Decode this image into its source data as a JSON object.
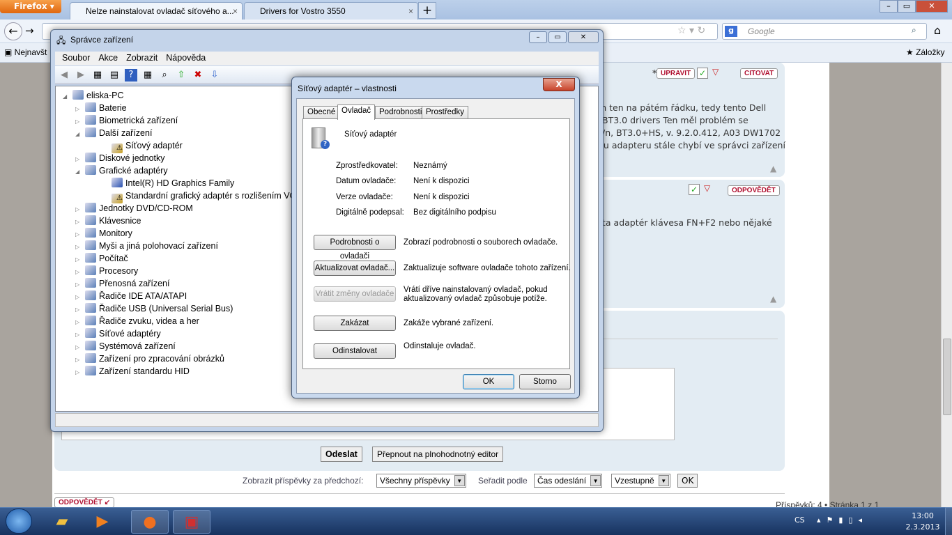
{
  "browser": {
    "menu_button": "Firefox",
    "tabs": [
      {
        "title": "Nelze nainstalovat ovladač síťového a..."
      },
      {
        "title": "Drivers for Vostro 3550"
      }
    ],
    "search_placeholder": "Google",
    "bookmarks_left": "Nejnavšt",
    "bookmarks_right": "Záložky"
  },
  "forum": {
    "post1": {
      "buttons": {
        "edit": "UPRAVIT",
        "quote": "CITOVAT"
      },
      "lines": [
        "m ten na pátém řádku, tedy tento Dell",
        "BT3.0 drivers Ten měl problém se",
        "/n, BT3.0+HS, v. 9.2.0.412, A03 DW1702",
        "nu adapteru stále chybí ve správci zařízení"
      ]
    },
    "post2": {
      "buttons": {
        "reply": "ODPOVĚDĚT"
      },
      "lines": [
        "ta adaptér klávesa FN+F2 nebo nějaké"
      ]
    },
    "submit": "Odeslat",
    "full_editor": "Přepnout na plnohodnotný editor",
    "filter_label": "Zobrazit příspěvky za předchozí:",
    "filter_value": "Všechny příspěvky",
    "sort_label": "Seřadit podle",
    "sort_value": "Čas odeslání",
    "order_value": "Vzestupně",
    "ok": "OK",
    "reply_button": "ODPOVĚDĚT",
    "pagination": "Příspěvků: 4 • Stránka 1 z 1"
  },
  "device_manager": {
    "title": "Správce zařízení",
    "menu": [
      "Soubor",
      "Akce",
      "Zobrazit",
      "Nápověda"
    ],
    "tree": [
      {
        "label": "eliska-PC",
        "level": 0,
        "state": "expanded"
      },
      {
        "label": "Baterie",
        "level": 1,
        "state": "collapsed"
      },
      {
        "label": "Biometrická zařízení",
        "level": 1,
        "state": "collapsed"
      },
      {
        "label": "Další zařízení",
        "level": 1,
        "state": "expanded"
      },
      {
        "label": "Síťový adaptér",
        "level": 2,
        "state": "warning"
      },
      {
        "label": "Diskové jednotky",
        "level": 1,
        "state": "collapsed"
      },
      {
        "label": "Grafické adaptéry",
        "level": 1,
        "state": "expanded"
      },
      {
        "label": "Intel(R) HD Graphics Family",
        "level": 2,
        "state": "leaf"
      },
      {
        "label": "Standardní grafický adaptér s rozlišením VGA",
        "level": 2,
        "state": "warning"
      },
      {
        "label": "Jednotky DVD/CD-ROM",
        "level": 1,
        "state": "collapsed"
      },
      {
        "label": "Klávesnice",
        "level": 1,
        "state": "collapsed"
      },
      {
        "label": "Monitory",
        "level": 1,
        "state": "collapsed"
      },
      {
        "label": "Myši a jiná polohovací zařízení",
        "level": 1,
        "state": "collapsed"
      },
      {
        "label": "Počítač",
        "level": 1,
        "state": "collapsed"
      },
      {
        "label": "Procesory",
        "level": 1,
        "state": "collapsed"
      },
      {
        "label": "Přenosná zařízení",
        "level": 1,
        "state": "collapsed"
      },
      {
        "label": "Řadiče IDE ATA/ATAPI",
        "level": 1,
        "state": "collapsed"
      },
      {
        "label": "Řadiče USB (Universal Serial Bus)",
        "level": 1,
        "state": "collapsed"
      },
      {
        "label": "Řadiče zvuku, videa a her",
        "level": 1,
        "state": "collapsed"
      },
      {
        "label": "Síťové adaptéry",
        "level": 1,
        "state": "collapsed"
      },
      {
        "label": "Systémová zařízení",
        "level": 1,
        "state": "collapsed"
      },
      {
        "label": "Zařízení pro zpracování obrázků",
        "level": 1,
        "state": "collapsed"
      },
      {
        "label": "Zařízení standardu HID",
        "level": 1,
        "state": "collapsed"
      }
    ]
  },
  "dialog": {
    "title": "Síťový adaptér – vlastnosti",
    "close": "X",
    "tabs": [
      "Obecné",
      "Ovladač",
      "Podrobnosti",
      "Prostředky"
    ],
    "active_tab": "Ovladač",
    "device_name": "Síťový adaptér",
    "props": [
      {
        "label": "Zprostředkovatel:",
        "value": "Neznámý"
      },
      {
        "label": "Datum ovladače:",
        "value": "Není k dispozici"
      },
      {
        "label": "Verze ovladače:",
        "value": "Není k dispozici"
      },
      {
        "label": "Digitálně podepsal:",
        "value": "Bez digitálního podpisu"
      }
    ],
    "actions": [
      {
        "button": "Podrobnosti o ovladači",
        "desc": "Zobrazí podrobnosti o souborech ovladače.",
        "enabled": true
      },
      {
        "button": "Aktualizovat ovladač...",
        "desc": "Zaktualizuje software ovladače tohoto zařízení.",
        "enabled": true
      },
      {
        "button": "Vrátit změny ovladače",
        "desc": "Vrátí dříve nainstalovaný ovladač, pokud aktualizovaný ovladač způsobuje potíže.",
        "enabled": false
      },
      {
        "button": "Zakázat",
        "desc": "Zakáže vybrané zařízení.",
        "enabled": true
      },
      {
        "button": "Odinstalovat",
        "desc": "Odinstaluje ovladač.",
        "enabled": true
      }
    ],
    "ok": "OK",
    "cancel": "Storno"
  },
  "taskbar": {
    "language": "CS",
    "time": "13:00",
    "date": "2.3.2013"
  }
}
